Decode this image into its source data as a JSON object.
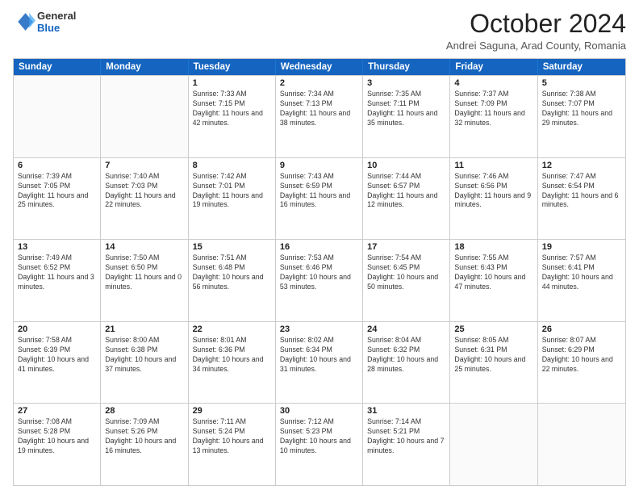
{
  "header": {
    "logo": {
      "general": "General",
      "blue": "Blue"
    },
    "title": "October 2024",
    "subtitle": "Andrei Saguna, Arad County, Romania"
  },
  "calendar": {
    "headers": [
      "Sunday",
      "Monday",
      "Tuesday",
      "Wednesday",
      "Thursday",
      "Friday",
      "Saturday"
    ],
    "rows": [
      [
        {
          "day": "",
          "info": ""
        },
        {
          "day": "",
          "info": ""
        },
        {
          "day": "1",
          "sunrise": "Sunrise: 7:33 AM",
          "sunset": "Sunset: 7:15 PM",
          "daylight": "Daylight: 11 hours and 42 minutes."
        },
        {
          "day": "2",
          "sunrise": "Sunrise: 7:34 AM",
          "sunset": "Sunset: 7:13 PM",
          "daylight": "Daylight: 11 hours and 38 minutes."
        },
        {
          "day": "3",
          "sunrise": "Sunrise: 7:35 AM",
          "sunset": "Sunset: 7:11 PM",
          "daylight": "Daylight: 11 hours and 35 minutes."
        },
        {
          "day": "4",
          "sunrise": "Sunrise: 7:37 AM",
          "sunset": "Sunset: 7:09 PM",
          "daylight": "Daylight: 11 hours and 32 minutes."
        },
        {
          "day": "5",
          "sunrise": "Sunrise: 7:38 AM",
          "sunset": "Sunset: 7:07 PM",
          "daylight": "Daylight: 11 hours and 29 minutes."
        }
      ],
      [
        {
          "day": "6",
          "sunrise": "Sunrise: 7:39 AM",
          "sunset": "Sunset: 7:05 PM",
          "daylight": "Daylight: 11 hours and 25 minutes."
        },
        {
          "day": "7",
          "sunrise": "Sunrise: 7:40 AM",
          "sunset": "Sunset: 7:03 PM",
          "daylight": "Daylight: 11 hours and 22 minutes."
        },
        {
          "day": "8",
          "sunrise": "Sunrise: 7:42 AM",
          "sunset": "Sunset: 7:01 PM",
          "daylight": "Daylight: 11 hours and 19 minutes."
        },
        {
          "day": "9",
          "sunrise": "Sunrise: 7:43 AM",
          "sunset": "Sunset: 6:59 PM",
          "daylight": "Daylight: 11 hours and 16 minutes."
        },
        {
          "day": "10",
          "sunrise": "Sunrise: 7:44 AM",
          "sunset": "Sunset: 6:57 PM",
          "daylight": "Daylight: 11 hours and 12 minutes."
        },
        {
          "day": "11",
          "sunrise": "Sunrise: 7:46 AM",
          "sunset": "Sunset: 6:56 PM",
          "daylight": "Daylight: 11 hours and 9 minutes."
        },
        {
          "day": "12",
          "sunrise": "Sunrise: 7:47 AM",
          "sunset": "Sunset: 6:54 PM",
          "daylight": "Daylight: 11 hours and 6 minutes."
        }
      ],
      [
        {
          "day": "13",
          "sunrise": "Sunrise: 7:49 AM",
          "sunset": "Sunset: 6:52 PM",
          "daylight": "Daylight: 11 hours and 3 minutes."
        },
        {
          "day": "14",
          "sunrise": "Sunrise: 7:50 AM",
          "sunset": "Sunset: 6:50 PM",
          "daylight": "Daylight: 11 hours and 0 minutes."
        },
        {
          "day": "15",
          "sunrise": "Sunrise: 7:51 AM",
          "sunset": "Sunset: 6:48 PM",
          "daylight": "Daylight: 10 hours and 56 minutes."
        },
        {
          "day": "16",
          "sunrise": "Sunrise: 7:53 AM",
          "sunset": "Sunset: 6:46 PM",
          "daylight": "Daylight: 10 hours and 53 minutes."
        },
        {
          "day": "17",
          "sunrise": "Sunrise: 7:54 AM",
          "sunset": "Sunset: 6:45 PM",
          "daylight": "Daylight: 10 hours and 50 minutes."
        },
        {
          "day": "18",
          "sunrise": "Sunrise: 7:55 AM",
          "sunset": "Sunset: 6:43 PM",
          "daylight": "Daylight: 10 hours and 47 minutes."
        },
        {
          "day": "19",
          "sunrise": "Sunrise: 7:57 AM",
          "sunset": "Sunset: 6:41 PM",
          "daylight": "Daylight: 10 hours and 44 minutes."
        }
      ],
      [
        {
          "day": "20",
          "sunrise": "Sunrise: 7:58 AM",
          "sunset": "Sunset: 6:39 PM",
          "daylight": "Daylight: 10 hours and 41 minutes."
        },
        {
          "day": "21",
          "sunrise": "Sunrise: 8:00 AM",
          "sunset": "Sunset: 6:38 PM",
          "daylight": "Daylight: 10 hours and 37 minutes."
        },
        {
          "day": "22",
          "sunrise": "Sunrise: 8:01 AM",
          "sunset": "Sunset: 6:36 PM",
          "daylight": "Daylight: 10 hours and 34 minutes."
        },
        {
          "day": "23",
          "sunrise": "Sunrise: 8:02 AM",
          "sunset": "Sunset: 6:34 PM",
          "daylight": "Daylight: 10 hours and 31 minutes."
        },
        {
          "day": "24",
          "sunrise": "Sunrise: 8:04 AM",
          "sunset": "Sunset: 6:32 PM",
          "daylight": "Daylight: 10 hours and 28 minutes."
        },
        {
          "day": "25",
          "sunrise": "Sunrise: 8:05 AM",
          "sunset": "Sunset: 6:31 PM",
          "daylight": "Daylight: 10 hours and 25 minutes."
        },
        {
          "day": "26",
          "sunrise": "Sunrise: 8:07 AM",
          "sunset": "Sunset: 6:29 PM",
          "daylight": "Daylight: 10 hours and 22 minutes."
        }
      ],
      [
        {
          "day": "27",
          "sunrise": "Sunrise: 7:08 AM",
          "sunset": "Sunset: 5:28 PM",
          "daylight": "Daylight: 10 hours and 19 minutes."
        },
        {
          "day": "28",
          "sunrise": "Sunrise: 7:09 AM",
          "sunset": "Sunset: 5:26 PM",
          "daylight": "Daylight: 10 hours and 16 minutes."
        },
        {
          "day": "29",
          "sunrise": "Sunrise: 7:11 AM",
          "sunset": "Sunset: 5:24 PM",
          "daylight": "Daylight: 10 hours and 13 minutes."
        },
        {
          "day": "30",
          "sunrise": "Sunrise: 7:12 AM",
          "sunset": "Sunset: 5:23 PM",
          "daylight": "Daylight: 10 hours and 10 minutes."
        },
        {
          "day": "31",
          "sunrise": "Sunrise: 7:14 AM",
          "sunset": "Sunset: 5:21 PM",
          "daylight": "Daylight: 10 hours and 7 minutes."
        },
        {
          "day": "",
          "info": ""
        },
        {
          "day": "",
          "info": ""
        }
      ]
    ]
  }
}
